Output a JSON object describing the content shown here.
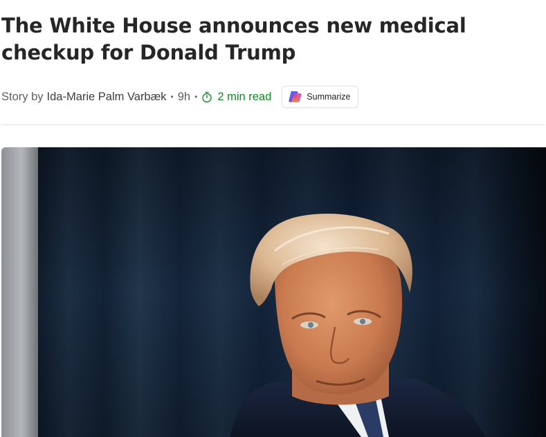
{
  "article": {
    "title": "The White House announces new medical checkup for Donald Trump",
    "byline": {
      "prefix": "Story by",
      "author": "Ida-Marie Palm Varbæk",
      "separator": "•",
      "age": "9h",
      "read_time": "2 min read",
      "read_time_icon": "stopwatch-icon",
      "read_time_color": "#0f8a20"
    },
    "summarize": {
      "label": "Summarize",
      "icon": "copilot-icon"
    },
    "hero_image": {
      "description_icon": "photo-portrait"
    }
  }
}
